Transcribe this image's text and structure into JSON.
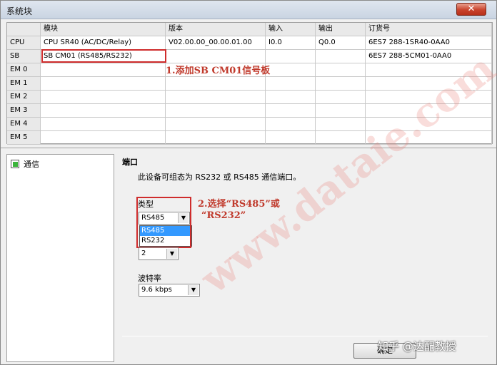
{
  "window": {
    "title": "系统块",
    "close_label": "✕"
  },
  "grid": {
    "headers": [
      "",
      "模块",
      "版本",
      "输入",
      "输出",
      "订货号"
    ],
    "rows": [
      {
        "slot": "CPU",
        "module": "CPU SR40 (AC/DC/Relay)",
        "version": "V02.00.00_00.00.01.00",
        "input": "I0.0",
        "output": "Q0.0",
        "order": "6ES7 288-1SR40-0AA0"
      },
      {
        "slot": "SB",
        "module": "SB CM01 (RS485/RS232)",
        "version": "",
        "input": "",
        "output": "",
        "order": "6ES7 288-5CM01-0AA0"
      },
      {
        "slot": "EM 0",
        "module": "",
        "version": "",
        "input": "",
        "output": "",
        "order": ""
      },
      {
        "slot": "EM 1",
        "module": "",
        "version": "",
        "input": "",
        "output": "",
        "order": ""
      },
      {
        "slot": "EM 2",
        "module": "",
        "version": "",
        "input": "",
        "output": "",
        "order": ""
      },
      {
        "slot": "EM 3",
        "module": "",
        "version": "",
        "input": "",
        "output": "",
        "order": ""
      },
      {
        "slot": "EM 4",
        "module": "",
        "version": "",
        "input": "",
        "output": "",
        "order": ""
      },
      {
        "slot": "EM 5",
        "module": "",
        "version": "",
        "input": "",
        "output": "",
        "order": ""
      }
    ]
  },
  "annotations": {
    "step1": "1.添加SB CM01信号板",
    "step2_line1": "2.选择“RS485”或",
    "step2_line2": "“RS232”"
  },
  "tree": {
    "item": "通信"
  },
  "panel": {
    "section_title": "端口",
    "description": "此设备可组态为 RS232 或 RS485 通信端口。",
    "type_label": "类型",
    "type_value": "RS485",
    "type_options": [
      "RS485",
      "RS232"
    ],
    "address_value": "2",
    "baud_label": "波特率",
    "baud_value": "9.6 kbps",
    "ok_label": "确定"
  },
  "watermark": "www.dataie.com",
  "brand": "知乎 @达配教授",
  "icons": {
    "dropdown_arrow": "▼",
    "tree_icon": "green-square"
  }
}
